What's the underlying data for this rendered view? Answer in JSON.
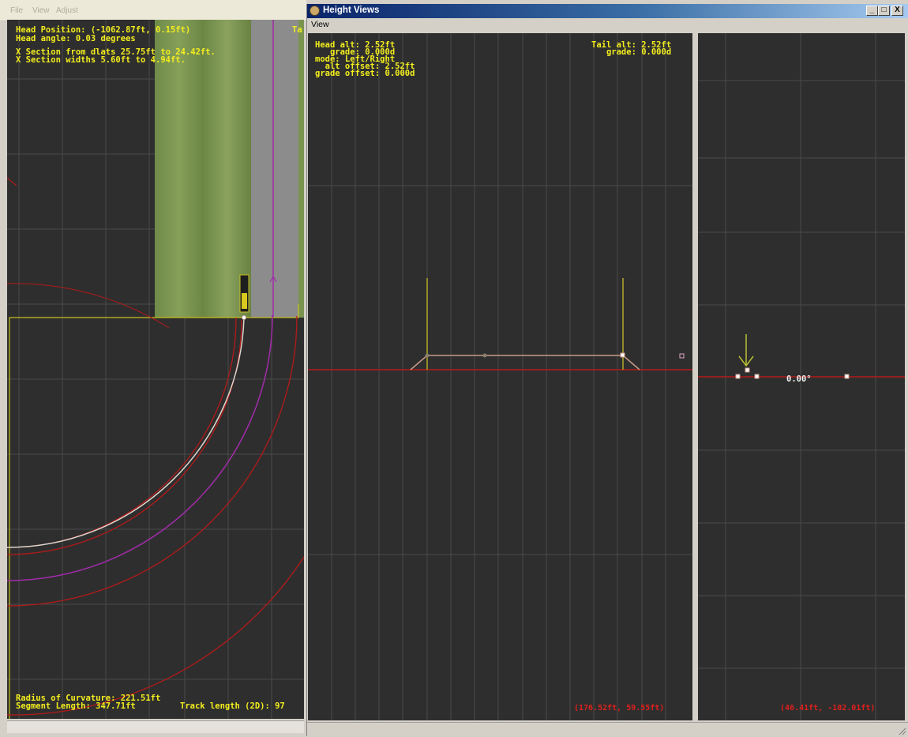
{
  "main_window": {
    "menu": [
      "File",
      "View",
      "Adjust"
    ],
    "plan_view": {
      "hud_top": [
        "Head Position: (-1062.87ft, 0.15ft)",
        "Head angle: 0.03 degrees",
        "",
        "X Section from dlats 25.75ft to 24.42ft.",
        "X Section widths 5.60ft to 4.94ft."
      ],
      "hud_top_right": "Ta",
      "hud_bottom": {
        "radius": "Radius of Curvature: 221.51ft",
        "segment": "Segment Length: 347.71ft",
        "track": "Track length (2D): 97"
      }
    }
  },
  "height_window": {
    "title": "Height Views",
    "caption_buttons": {
      "minimize": "_",
      "maximize": "□",
      "close": "X"
    },
    "menu": [
      "View"
    ],
    "left_view": {
      "head_info": [
        "Head alt: 2.52ft",
        "   grade: 0.000d",
        "mode: Left/Right",
        "  alt offset: 2.52ft",
        "grade offset: 0.000d"
      ],
      "tail_info": [
        "Tail alt: 2.52ft",
        "   grade: 0.000d"
      ],
      "coord_readout": "(176.52ft, 59.55ft)"
    },
    "right_view": {
      "angle_label": "0.00°",
      "coord_readout": "(46.41ft, -102.01ft)"
    }
  },
  "colors": {
    "viewport_bg": "#2e2e2e",
    "grid": "#4a4a4a",
    "hud_text": "#f4ee1e",
    "red_line": "#b41a1a",
    "magenta": "#a02ca8",
    "coord_text": "#e0201c"
  },
  "icons": [
    "app-icon",
    "minimize-icon",
    "maximize-icon",
    "close-icon",
    "resize-grip-icon",
    "down-arrow-icon"
  ]
}
